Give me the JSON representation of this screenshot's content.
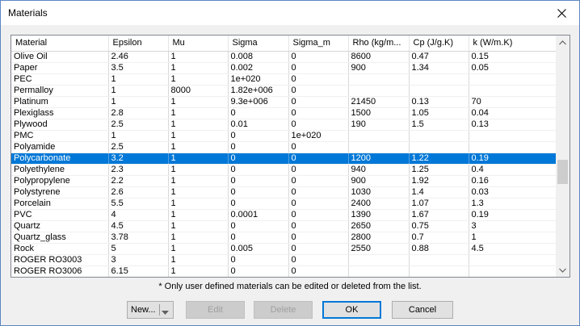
{
  "window": {
    "title": "Materials"
  },
  "columns": [
    "Material",
    "Epsilon",
    "Mu",
    "Sigma",
    "Sigma_m",
    "Rho (kg/m...",
    "Cp (J/g.K)",
    "k (W/m.K)"
  ],
  "rows": [
    [
      "Olive Oil",
      "2.46",
      "1",
      "0.008",
      "0",
      "8600",
      "0.47",
      "0.15"
    ],
    [
      "Paper",
      "3.5",
      "1",
      "0.002",
      "0",
      "900",
      "1.34",
      "0.05"
    ],
    [
      "PEC",
      "1",
      "1",
      "1e+020",
      "0",
      "",
      "",
      ""
    ],
    [
      "Permalloy",
      "1",
      "8000",
      "1.82e+006",
      "0",
      "",
      "",
      ""
    ],
    [
      "Platinum",
      "1",
      "1",
      "9.3e+006",
      "0",
      "21450",
      "0.13",
      "70"
    ],
    [
      "Plexiglass",
      "2.8",
      "1",
      "0",
      "0",
      "1500",
      "1.05",
      "0.04"
    ],
    [
      "Plywood",
      "2.5",
      "1",
      "0.01",
      "0",
      "190",
      "1.5",
      "0.13"
    ],
    [
      "PMC",
      "1",
      "1",
      "0",
      "1e+020",
      "",
      "",
      ""
    ],
    [
      "Polyamide",
      "2.5",
      "1",
      "0",
      "0",
      "",
      "",
      ""
    ],
    [
      "Polycarbonate",
      "3.2",
      "1",
      "0",
      "0",
      "1200",
      "1.22",
      "0.19"
    ],
    [
      "Polyethylene",
      "2.3",
      "1",
      "0",
      "0",
      "940",
      "1.25",
      "0.4"
    ],
    [
      "Polypropylene",
      "2.2",
      "1",
      "0",
      "0",
      "900",
      "1.92",
      "0.16"
    ],
    [
      "Polystyrene",
      "2.6",
      "1",
      "0",
      "0",
      "1030",
      "1.4",
      "0.03"
    ],
    [
      "Porcelain",
      "5.5",
      "1",
      "0",
      "0",
      "2400",
      "1.07",
      "1.3"
    ],
    [
      "PVC",
      "4",
      "1",
      "0.0001",
      "0",
      "1390",
      "1.67",
      "0.19"
    ],
    [
      "Quartz",
      "4.5",
      "1",
      "0",
      "0",
      "2650",
      "0.75",
      "3"
    ],
    [
      "Quartz_glass",
      "3.78",
      "1",
      "0",
      "0",
      "2800",
      "0.7",
      "1"
    ],
    [
      "Rock",
      "5",
      "1",
      "0.005",
      "0",
      "2550",
      "0.88",
      "4.5"
    ],
    [
      "ROGER RO3003",
      "3",
      "1",
      "0",
      "0",
      "",
      "",
      ""
    ],
    [
      "ROGER RO3006",
      "6.15",
      "1",
      "0",
      "0",
      "",
      "",
      ""
    ]
  ],
  "selected_row": "Polycarbonate",
  "note": "* Only user defined materials can be edited or deleted from the list.",
  "buttons": {
    "new": "New...",
    "edit": "Edit",
    "delete": "Delete",
    "ok": "OK",
    "cancel": "Cancel"
  },
  "icons": {
    "close": "close-icon",
    "scroll_up": "chevron-up-icon",
    "scroll_down": "chevron-down-icon",
    "new_dropdown": "caret-down-icon"
  },
  "colors": {
    "selection": "#0078d7",
    "frame": "#5a86c2",
    "dialog_bg": "#f0f0f0"
  }
}
